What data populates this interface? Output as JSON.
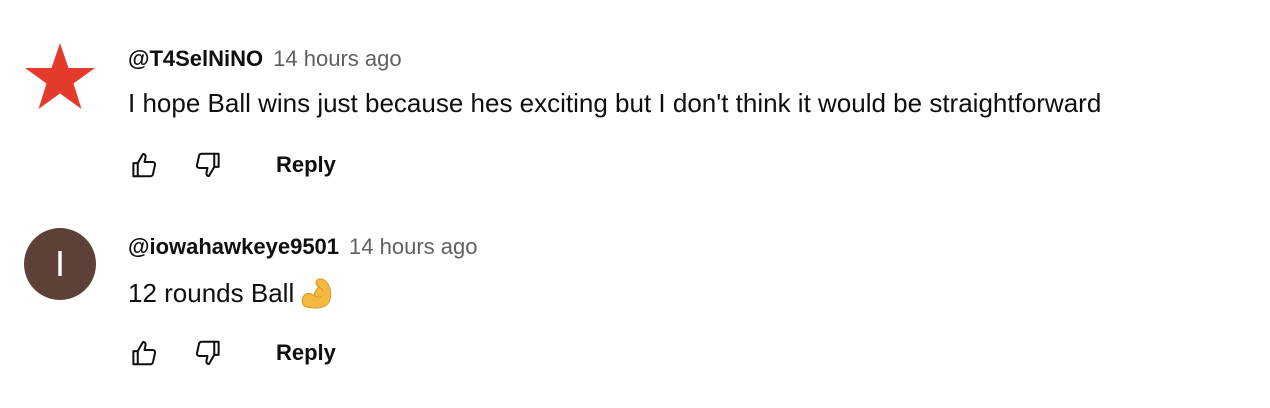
{
  "comments": [
    {
      "author": "@T4SelNiNO",
      "time": "14 hours ago",
      "text": "I hope Ball wins just because hes exciting but I don't think it would be straightforward",
      "avatar": {
        "type": "star-icon",
        "color": "#e43b2c"
      },
      "reply_label": "Reply",
      "like_icon": "thumbs-up-icon",
      "dislike_icon": "thumbs-down-icon"
    },
    {
      "author": "@iowahawkeye9501",
      "time": "14 hours ago",
      "text": "12 rounds Ball",
      "emoji": "flexed-biceps-icon",
      "avatar": {
        "type": "letter",
        "letter": "I",
        "color": "#5d4037"
      },
      "reply_label": "Reply",
      "like_icon": "thumbs-up-icon",
      "dislike_icon": "thumbs-down-icon"
    }
  ],
  "colors": {
    "text": "#0f0f0f",
    "secondary_text": "#606060",
    "star": "#e43b2c",
    "emoji": "#f4b740"
  }
}
